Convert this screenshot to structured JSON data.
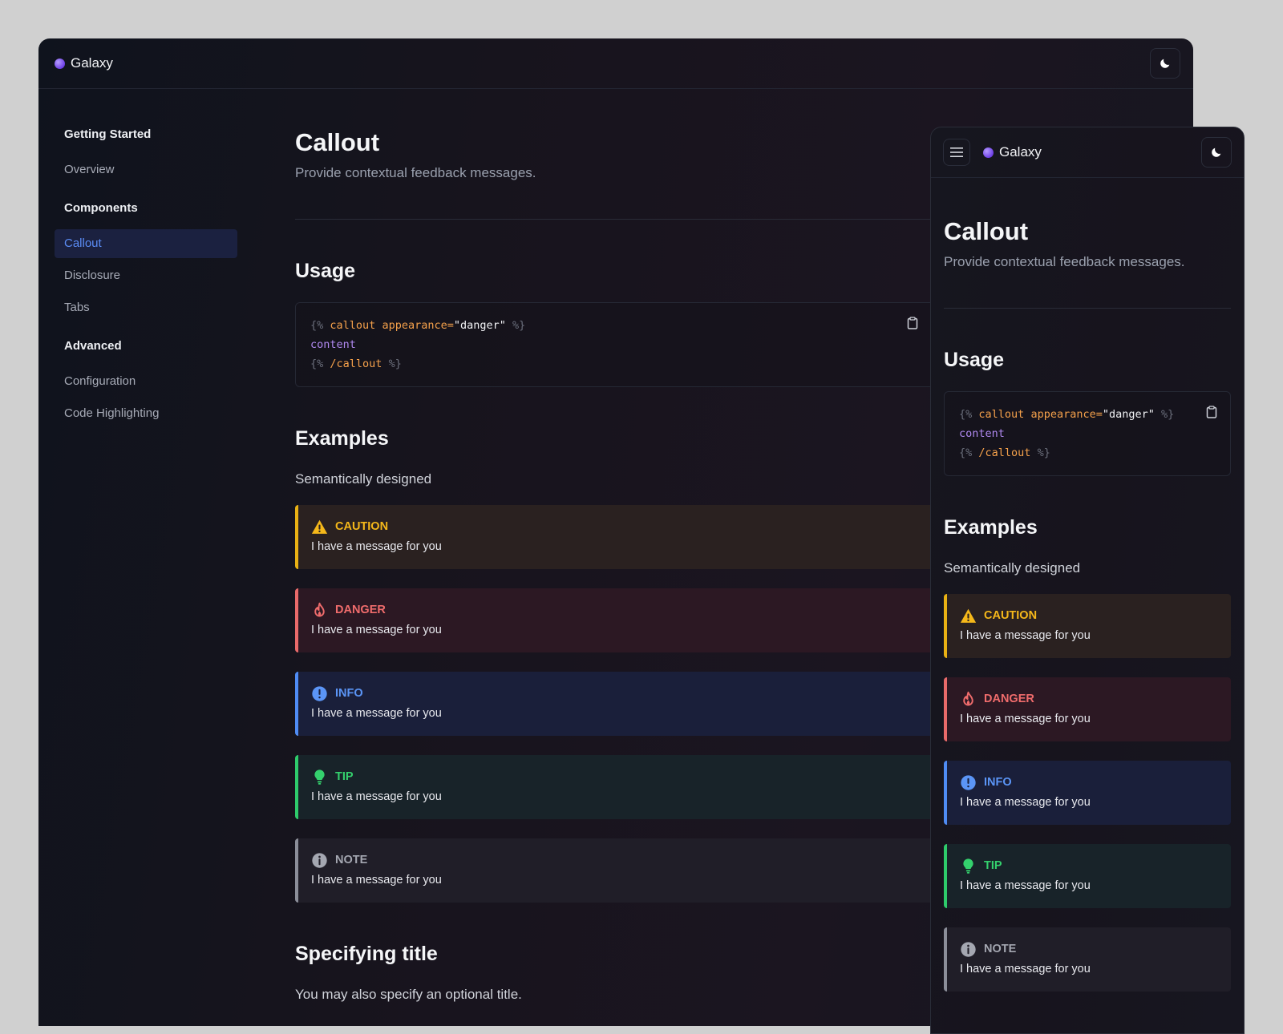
{
  "app": {
    "name": "Galaxy"
  },
  "sidebar": {
    "sections": [
      {
        "heading": "Getting Started",
        "items": [
          {
            "label": "Overview",
            "active": false
          }
        ]
      },
      {
        "heading": "Components",
        "items": [
          {
            "label": "Callout",
            "active": true
          },
          {
            "label": "Disclosure",
            "active": false
          },
          {
            "label": "Tabs",
            "active": false
          }
        ]
      },
      {
        "heading": "Advanced",
        "items": [
          {
            "label": "Configuration",
            "active": false
          },
          {
            "label": "Code Highlighting",
            "active": false
          }
        ]
      }
    ]
  },
  "page": {
    "title": "Callout",
    "lead": "Provide contextual feedback messages.",
    "usage_heading": "Usage",
    "code": {
      "open_brace": "{%",
      "tag": "callout",
      "attr": "appearance=",
      "attr_value": "\"danger\"",
      "close_brace": "%}",
      "body": "content",
      "end_open": "{%",
      "end_tag": "/callout",
      "end_close": "%}"
    },
    "examples_heading": "Examples",
    "examples_intro": "Semantically designed",
    "callouts": [
      {
        "kind": "caution",
        "title": "CAUTION",
        "message": "I have a message for you",
        "icon": "warning-icon"
      },
      {
        "kind": "danger",
        "title": "DANGER",
        "message": "I have a message for you",
        "icon": "fire-icon"
      },
      {
        "kind": "info",
        "title": "INFO",
        "message": "I have a message for you",
        "icon": "exclamation-circle-icon"
      },
      {
        "kind": "tip",
        "title": "TIP",
        "message": "I have a message for you",
        "icon": "lightbulb-icon"
      },
      {
        "kind": "note",
        "title": "NOTE",
        "message": "I have a message for you",
        "icon": "info-circle-icon"
      }
    ],
    "specifying_heading": "Specifying title",
    "specifying_text": "You may also specify an optional title."
  },
  "colors": {
    "caution": "#f5b81a",
    "danger": "#f06c6c",
    "info": "#5b95f6",
    "tip": "#34d16d",
    "note": "#a4a7b1",
    "active_link": "#5b8cf5",
    "code_tag": "#f5a14b",
    "code_keyword": "#b089f0"
  }
}
